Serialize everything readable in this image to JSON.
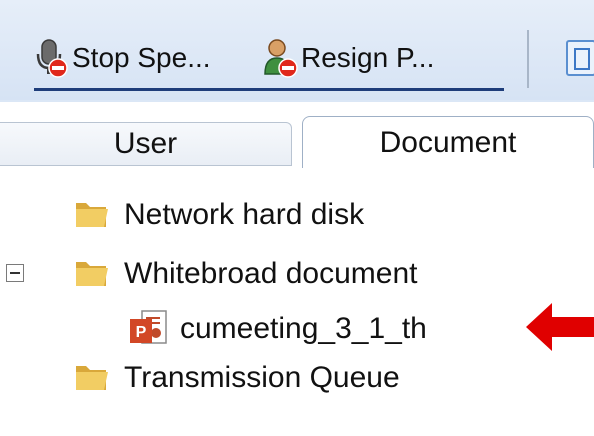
{
  "toolbar": {
    "stop_speaking_label": "Stop Spe...",
    "resign_presenter_label": "Resign P..."
  },
  "tabs": [
    {
      "label": "User",
      "selected": false
    },
    {
      "label": "Document",
      "selected": true
    }
  ],
  "tree": {
    "items": [
      {
        "label": "Network hard disk",
        "icon": "folder-icon"
      },
      {
        "label": "Whitebroad document",
        "icon": "folder-icon",
        "expanded": true
      },
      {
        "label": "cumeeting_3_1_th",
        "icon": "powerpoint-file-icon",
        "child_of": "Whitebroad document"
      },
      {
        "label": "Transmission Queue",
        "icon": "folder-icon"
      }
    ]
  },
  "colors": {
    "toolbar_bg": "#dbe7f6",
    "accent_underline": "#1e3d7a",
    "annotation_arrow": "#e00000",
    "folder": "#e8c35a",
    "powerpoint": "#d24726"
  }
}
